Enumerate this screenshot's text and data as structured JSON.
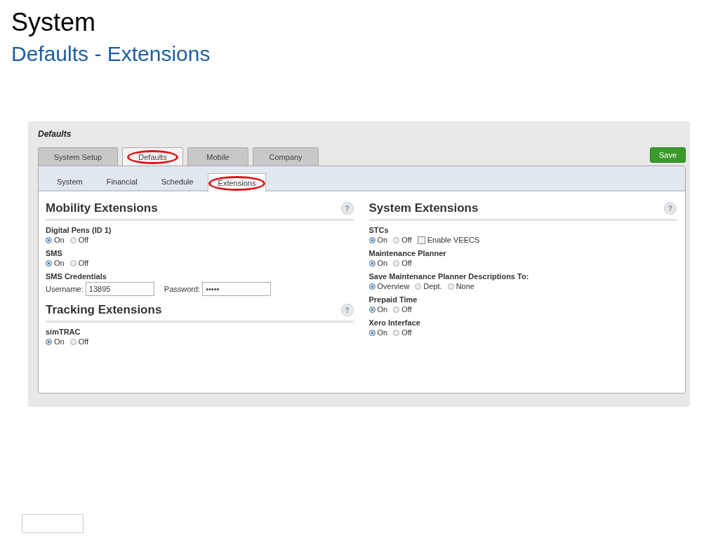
{
  "slide": {
    "title": "System",
    "subtitle": "Defaults - Extensions"
  },
  "panel": {
    "title": "Defaults",
    "tabs": [
      {
        "label": "System Setup",
        "selected": false,
        "circled": false
      },
      {
        "label": "Defaults",
        "selected": true,
        "circled": true
      },
      {
        "label": "Mobile",
        "selected": false,
        "circled": false
      },
      {
        "label": "Company",
        "selected": false,
        "circled": false
      }
    ],
    "save_button": "Save",
    "subtabs": [
      {
        "label": "System",
        "selected": false,
        "circled": false
      },
      {
        "label": "Financial",
        "selected": false,
        "circled": false
      },
      {
        "label": "Schedule",
        "selected": false,
        "circled": false
      },
      {
        "label": "Extensions",
        "selected": true,
        "circled": true
      }
    ],
    "columns": [
      {
        "sections": [
          {
            "title": "Mobility Extensions",
            "help": "?",
            "settings": [
              {
                "kind": "radio",
                "label": "Digital Pens (ID 1)",
                "options": [
                  {
                    "label": "On",
                    "selected": true
                  },
                  {
                    "label": "Off",
                    "selected": false
                  }
                ]
              },
              {
                "kind": "radio",
                "label": "SMS",
                "options": [
                  {
                    "label": "On",
                    "selected": true
                  },
                  {
                    "label": "Off",
                    "selected": false
                  }
                ]
              },
              {
                "kind": "credentials",
                "label": "SMS Credentials",
                "fields": [
                  {
                    "label": "Username:",
                    "value": "13895"
                  },
                  {
                    "label": "Password:",
                    "value": "•••••"
                  }
                ]
              }
            ]
          },
          {
            "title": "Tracking Extensions",
            "help": "?",
            "settings": [
              {
                "kind": "radio",
                "label": "simTRAC",
                "options": [
                  {
                    "label": "On",
                    "selected": true
                  },
                  {
                    "label": "Off",
                    "selected": false
                  }
                ]
              }
            ]
          }
        ]
      },
      {
        "sections": [
          {
            "title": "System Extensions",
            "help": "?",
            "settings": [
              {
                "kind": "radio",
                "label": "STCs",
                "options": [
                  {
                    "label": "On",
                    "selected": true
                  },
                  {
                    "label": "Off",
                    "selected": false
                  }
                ],
                "checkbox": {
                  "label": "Enable VEECS",
                  "checked": false
                }
              },
              {
                "kind": "radio",
                "label": "Maintenance Planner",
                "options": [
                  {
                    "label": "On",
                    "selected": true
                  },
                  {
                    "label": "Off",
                    "selected": false
                  }
                ]
              },
              {
                "kind": "radio",
                "label": "Save Maintenance Planner Descriptions To:",
                "options": [
                  {
                    "label": "Overview",
                    "selected": true
                  },
                  {
                    "label": "Dept.",
                    "selected": false
                  },
                  {
                    "label": "None",
                    "selected": false
                  }
                ]
              },
              {
                "kind": "radio",
                "label": "Prepaid Time",
                "options": [
                  {
                    "label": "On",
                    "selected": true
                  },
                  {
                    "label": "Off",
                    "selected": false
                  }
                ]
              },
              {
                "kind": "radio",
                "label": "Xero Interface",
                "options": [
                  {
                    "label": "On",
                    "selected": true
                  },
                  {
                    "label": "Off",
                    "selected": false
                  }
                ]
              }
            ]
          }
        ]
      }
    ]
  }
}
